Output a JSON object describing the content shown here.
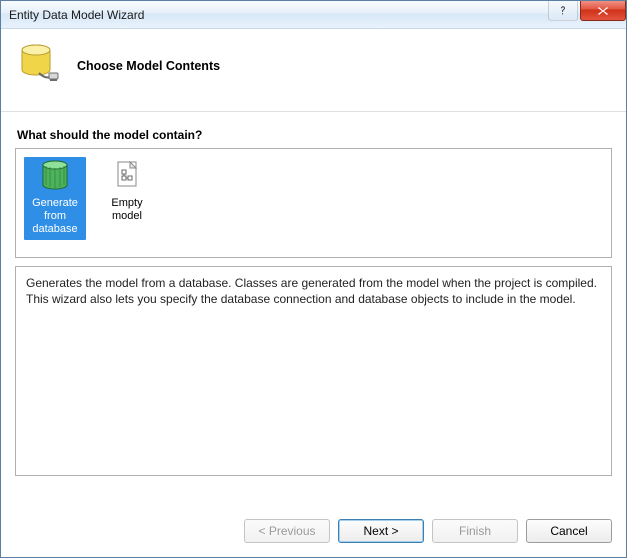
{
  "window": {
    "title": "Entity Data Model Wizard"
  },
  "header": {
    "heading": "Choose Model Contents"
  },
  "body": {
    "prompt": "What should the model contain?",
    "options": [
      {
        "label": "Generate from database",
        "selected": true
      },
      {
        "label": "Empty model",
        "selected": false
      }
    ],
    "description": "Generates the model from a database. Classes are generated from the model when the project is compiled. This wizard also lets you specify the database connection and database objects to include in the model."
  },
  "footer": {
    "previous": "< Previous",
    "next": "Next >",
    "finish": "Finish",
    "cancel": "Cancel"
  }
}
